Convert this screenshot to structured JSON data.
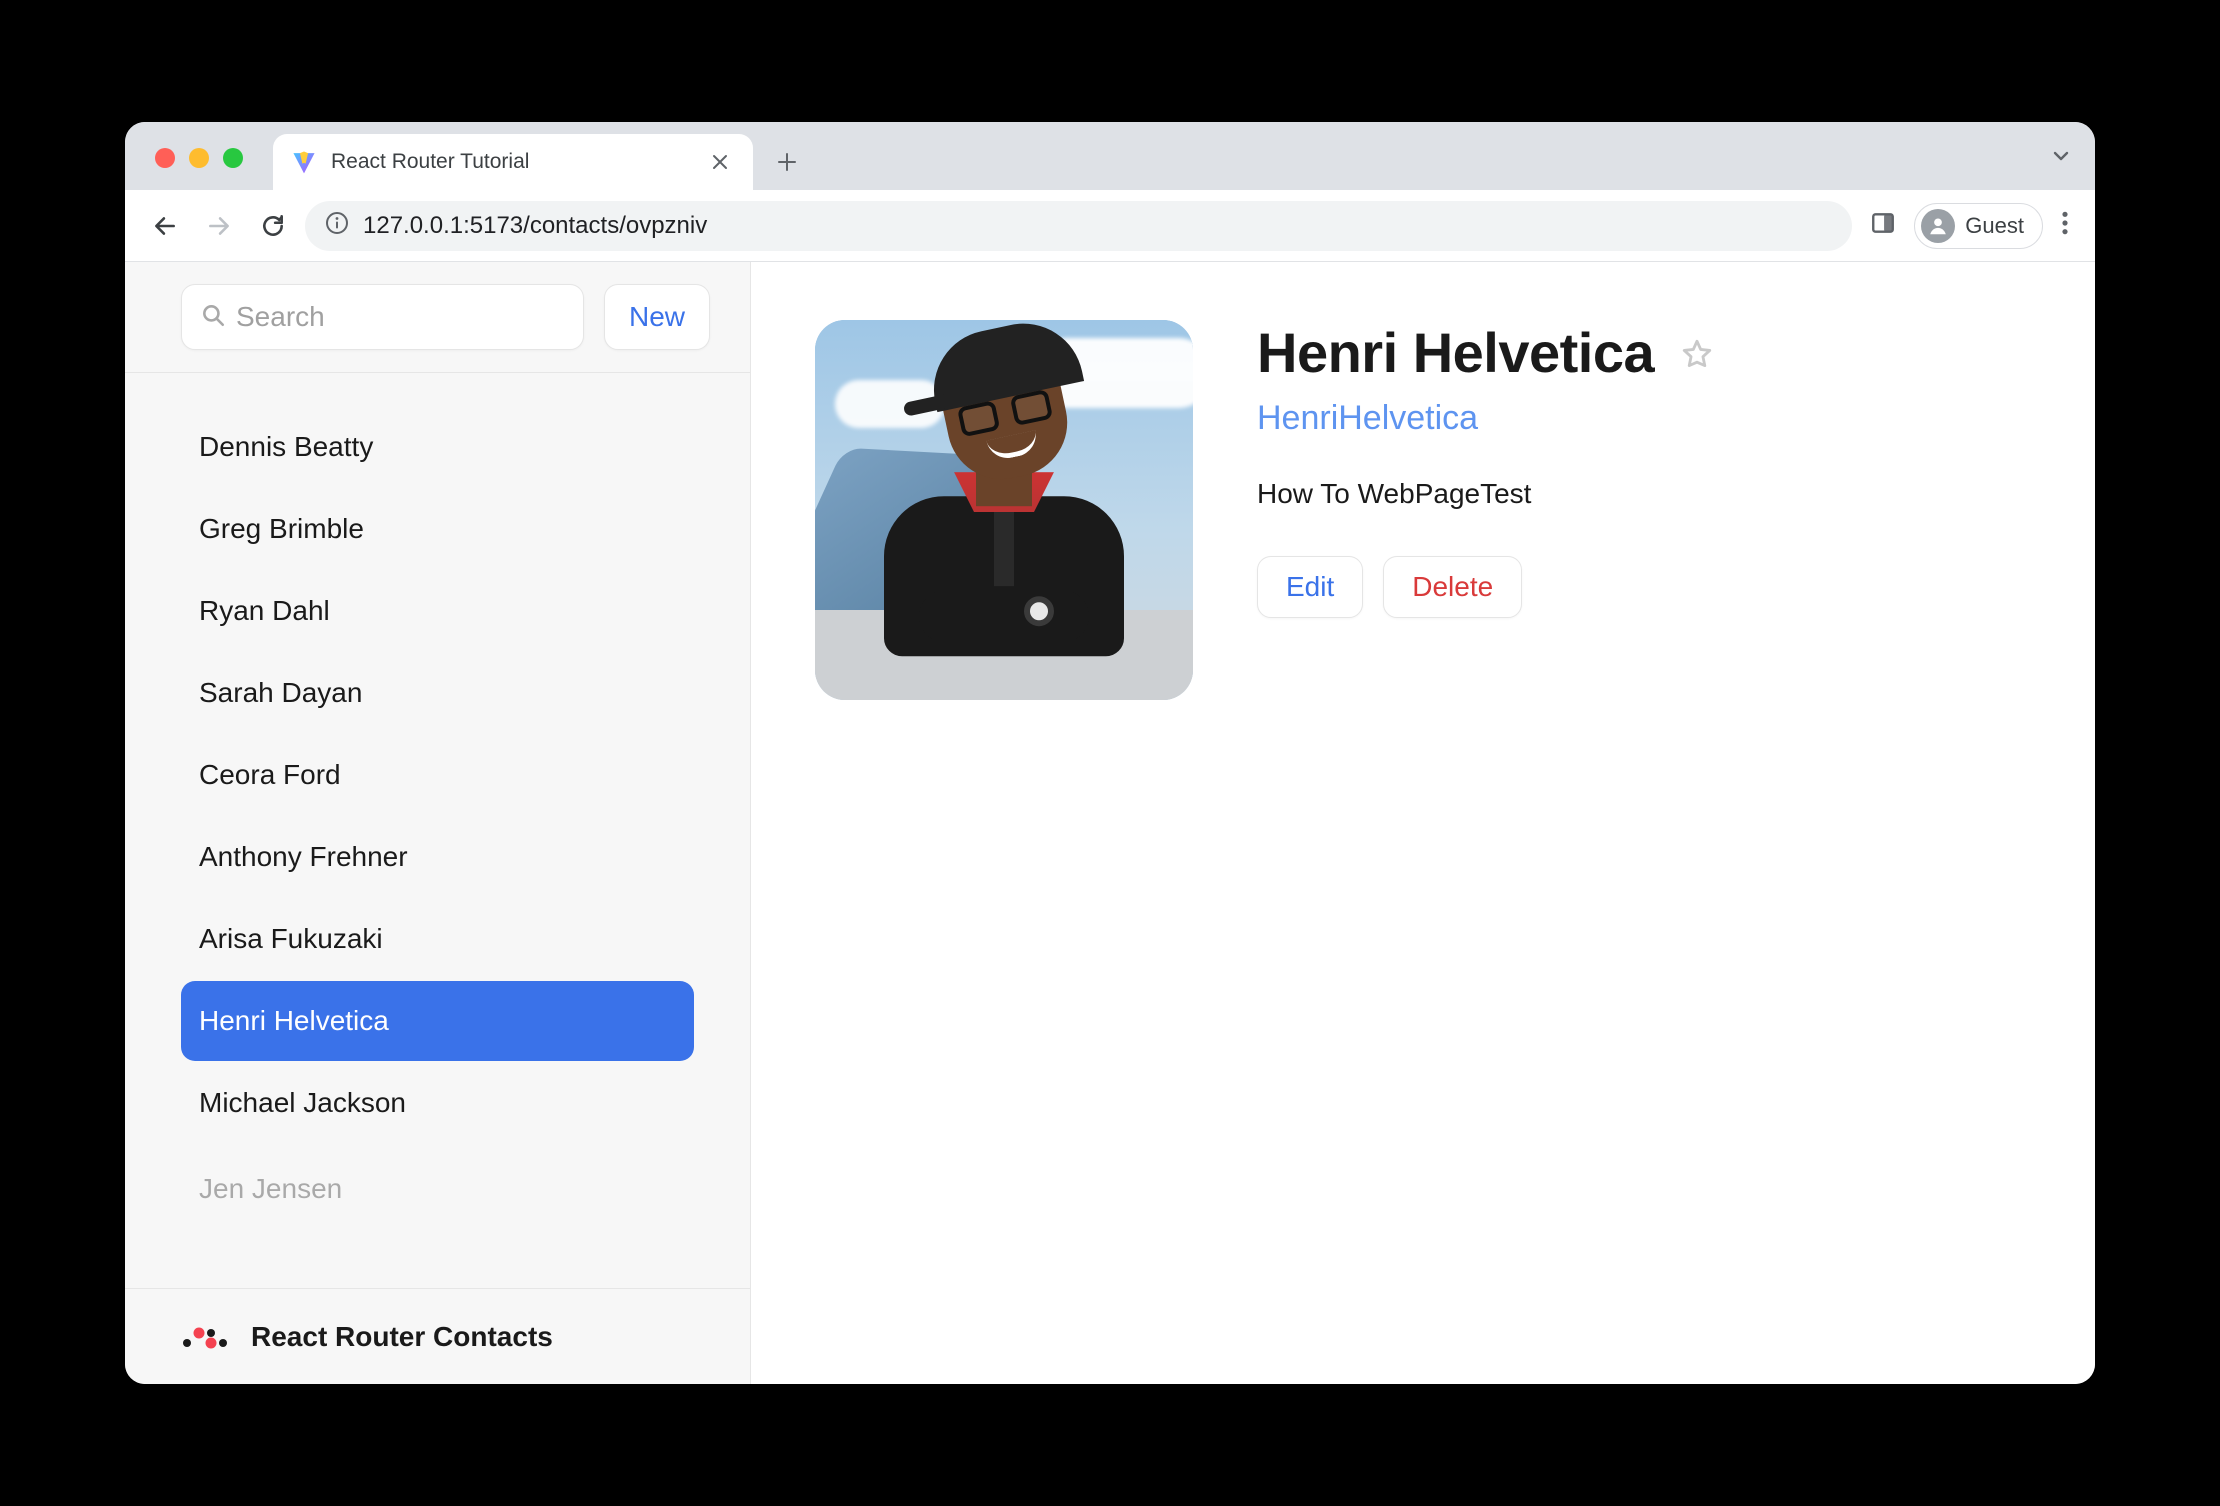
{
  "browser": {
    "tab_title": "React Router Tutorial",
    "url": "127.0.0.1:5173/contacts/ovpzniv",
    "guest_label": "Guest"
  },
  "sidebar": {
    "search_placeholder": "Search",
    "new_button": "New",
    "contacts": [
      {
        "name": "Dennis Beatty",
        "selected": false
      },
      {
        "name": "Greg Brimble",
        "selected": false
      },
      {
        "name": "Ryan Dahl",
        "selected": false
      },
      {
        "name": "Sarah Dayan",
        "selected": false
      },
      {
        "name": "Ceora Ford",
        "selected": false
      },
      {
        "name": "Anthony Frehner",
        "selected": false
      },
      {
        "name": "Arisa Fukuzaki",
        "selected": false
      },
      {
        "name": "Henri Helvetica",
        "selected": true
      },
      {
        "name": "Michael Jackson",
        "selected": false
      },
      {
        "name": "Jen Jensen",
        "selected": false,
        "cutoff": true
      }
    ],
    "footer_title": "React Router Contacts"
  },
  "detail": {
    "name": "Henri Helvetica",
    "handle": "HenriHelvetica",
    "bio": "How To WebPageTest",
    "edit_label": "Edit",
    "delete_label": "Delete"
  }
}
